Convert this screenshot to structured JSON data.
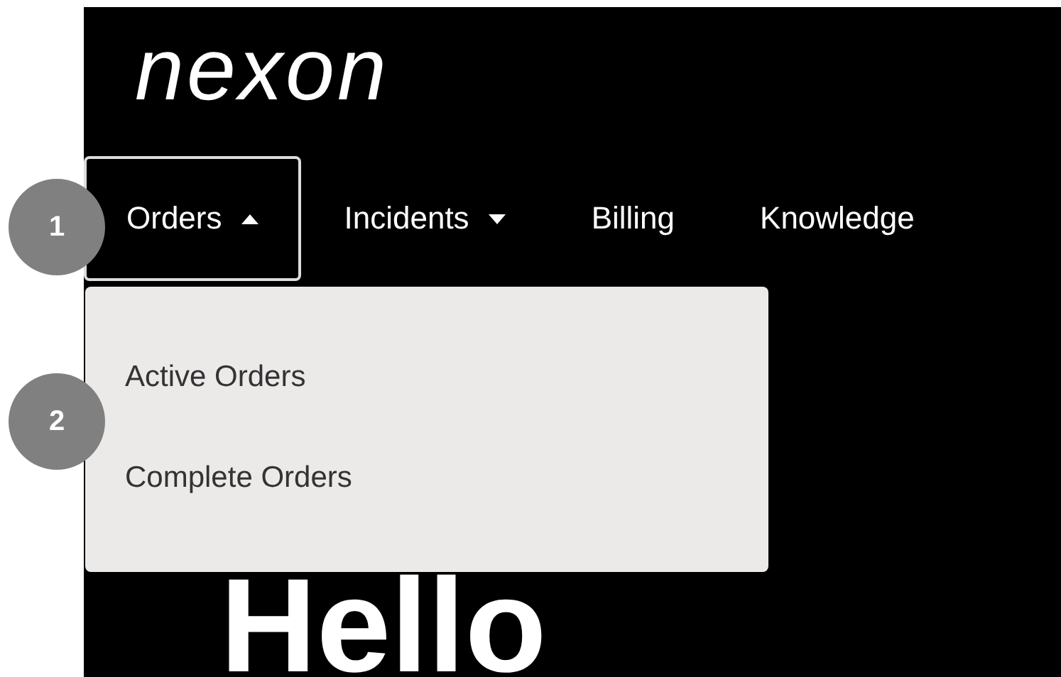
{
  "logo": {
    "text": "nexon"
  },
  "nav": {
    "items": [
      {
        "label": "Orders",
        "kind": "dropdown",
        "selected": true,
        "expanded": true,
        "menu": [
          "Active Orders",
          "Complete Orders"
        ]
      },
      {
        "label": "Incidents",
        "kind": "dropdown",
        "selected": false,
        "expanded": false
      },
      {
        "label": "Billing",
        "kind": "link",
        "selected": false
      },
      {
        "label": "Knowledge",
        "kind": "link",
        "selected": false
      }
    ]
  },
  "hero": {
    "heading": "Hello"
  },
  "callouts": [
    {
      "label": "1"
    },
    {
      "label": "2"
    }
  ]
}
